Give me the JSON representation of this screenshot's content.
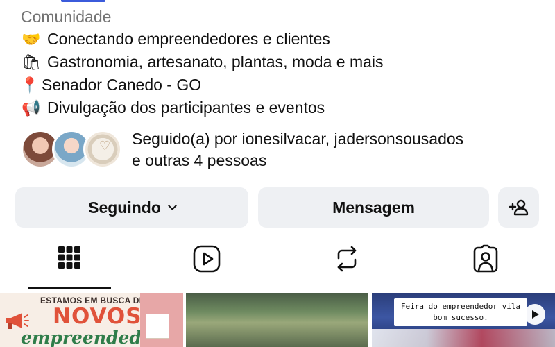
{
  "profile": {
    "category": "Comunidade",
    "bio_lines": [
      {
        "icon": "handshake-icon",
        "glyph": "🤝",
        "text": "Conectando empreendedores e clientes"
      },
      {
        "icon": "shop-icon",
        "glyph": "🛍",
        "text": "Gastronomia, artesanato, plantas, moda e mais"
      },
      {
        "icon": "pin-icon",
        "glyph": "📍",
        "text": "Senador Canedo - GO"
      },
      {
        "icon": "megaphone-icon",
        "glyph": "📢",
        "text": "Divulgação dos participantes e eventos"
      }
    ],
    "followed_by_line1": "Seguido(a) por ionesilvacar, jadersonsousados",
    "followed_by_line2": "e outras 4 pessoas"
  },
  "actions": {
    "following_label": "Seguindo",
    "message_label": "Mensagem"
  },
  "tabs": [
    {
      "name": "posts-grid",
      "icon": "grid-icon",
      "active": true
    },
    {
      "name": "reels",
      "icon": "reels-icon",
      "active": false
    },
    {
      "name": "reposts",
      "icon": "repost-icon",
      "active": false
    },
    {
      "name": "tagged",
      "icon": "tagged-icon",
      "active": false
    }
  ],
  "posts": [
    {
      "heading": "ESTAMOS EM BUSCA DE",
      "title": "NOVOS",
      "subtitle": "empreendedores!"
    },
    {},
    {
      "caption": "Feira do empreendedor vila bom sucesso."
    }
  ],
  "colors": {
    "button_bg": "#eef0f3",
    "text": "#111111",
    "muted": "#737373"
  }
}
